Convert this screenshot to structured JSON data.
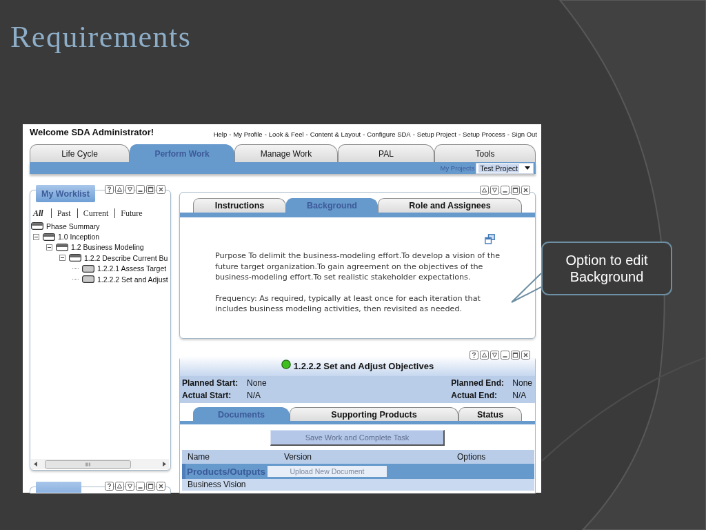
{
  "slide": {
    "title": "Requirements"
  },
  "app": {
    "welcome": "Welcome SDA Administrator!",
    "links": [
      {
        "label": "Help",
        "separator": "-"
      },
      {
        "label": "My Profile",
        "separator": "-"
      },
      {
        "label": "Look & Feel",
        "separator": "-"
      },
      {
        "label": "Content & Layout",
        "separator": "-"
      },
      {
        "label": "Configure SDA",
        "separator": "-"
      },
      {
        "label": "Setup Project",
        "separator": "-"
      },
      {
        "label": "Setup Process",
        "separator": "-"
      },
      {
        "label": "Sign Out"
      }
    ],
    "main_tabs": [
      {
        "label": "Life Cycle",
        "selected": false
      },
      {
        "label": "Perform Work",
        "selected": true
      },
      {
        "label": "Manage Work",
        "selected": false
      },
      {
        "label": "PAL",
        "selected": false
      },
      {
        "label": "Tools",
        "selected": false
      }
    ],
    "project_picker": {
      "label": "My Projects",
      "value": "Test Project"
    },
    "worklist": {
      "title": "My Worklist",
      "controls": [
        {
          "kind": "help"
        },
        {
          "kind": "up"
        },
        {
          "kind": "down"
        },
        {
          "kind": "minimize"
        },
        {
          "kind": "maximize"
        },
        {
          "kind": "close"
        }
      ],
      "filters": [
        {
          "label": "All",
          "selected": true
        },
        {
          "label": "Past",
          "selected": false
        },
        {
          "label": "Current",
          "selected": false
        },
        {
          "label": "Future",
          "selected": false
        }
      ],
      "tree": [
        {
          "label": "Phase Summary"
        },
        {
          "label": "1.0 Inception",
          "expanded": true,
          "children": [
            {
              "label": "1.2 Business Modeling",
              "expanded": true,
              "children": [
                {
                  "label": "1.2.2 Describe Current Bu",
                  "expanded": true,
                  "children": [
                    {
                      "label": "1.2.2.1 Assess Target"
                    },
                    {
                      "label": "1.2.2.2 Set and Adjust"
                    }
                  ]
                }
              ]
            }
          ]
        }
      ]
    },
    "lower_left_panel": {
      "controls": [
        {
          "kind": "help"
        },
        {
          "kind": "up"
        },
        {
          "kind": "down"
        },
        {
          "kind": "minimize"
        },
        {
          "kind": "maximize"
        },
        {
          "kind": "close"
        }
      ]
    },
    "background_panel": {
      "controls": [
        {
          "kind": "up"
        },
        {
          "kind": "down"
        },
        {
          "kind": "minimize"
        },
        {
          "kind": "maximize"
        },
        {
          "kind": "close"
        }
      ],
      "tabs": [
        {
          "label": "Instructions",
          "selected": false
        },
        {
          "label": "Background",
          "selected": true
        },
        {
          "label": "Role and Assignees",
          "selected": false
        }
      ],
      "paragraphs": [
        "Purpose To delimit the business-modeling effort.To develop a vision of the future target organization.To gain agreement on the objectives of the business-modeling effort.To set realistic stakeholder expectations.",
        "Frequency: As required, typically at least once for each iteration that includes business modeling activities, then revisited as needed."
      ]
    },
    "task_panel": {
      "controls": [
        {
          "kind": "help"
        },
        {
          "kind": "up"
        },
        {
          "kind": "down"
        },
        {
          "kind": "minimize"
        },
        {
          "kind": "maximize"
        },
        {
          "kind": "close"
        }
      ],
      "title": "1.2.2.2 Set and Adjust Objectives",
      "fields": [
        {
          "label": "Planned Start:",
          "value": "None"
        },
        {
          "label": "Planned End:",
          "value": "None"
        },
        {
          "label": "Actual Start:",
          "value": "N/A"
        },
        {
          "label": "Actual End:",
          "value": "N/A"
        }
      ],
      "tabs": [
        {
          "label": "Documents",
          "selected": true
        },
        {
          "label": "Supporting Products",
          "selected": false
        },
        {
          "label": "Status",
          "selected": false
        }
      ],
      "save_button": {
        "label": "Save Work and Complete Task",
        "disabled": true
      },
      "table": {
        "columns": [
          "Name",
          "Version",
          "Options"
        ],
        "group": {
          "label": "Products/Outputs",
          "button": {
            "label": "Upload New Document",
            "disabled": true
          }
        },
        "rows": [
          [
            "Business Vision"
          ]
        ]
      }
    }
  },
  "callout": {
    "text": "Option to edit Background"
  }
}
